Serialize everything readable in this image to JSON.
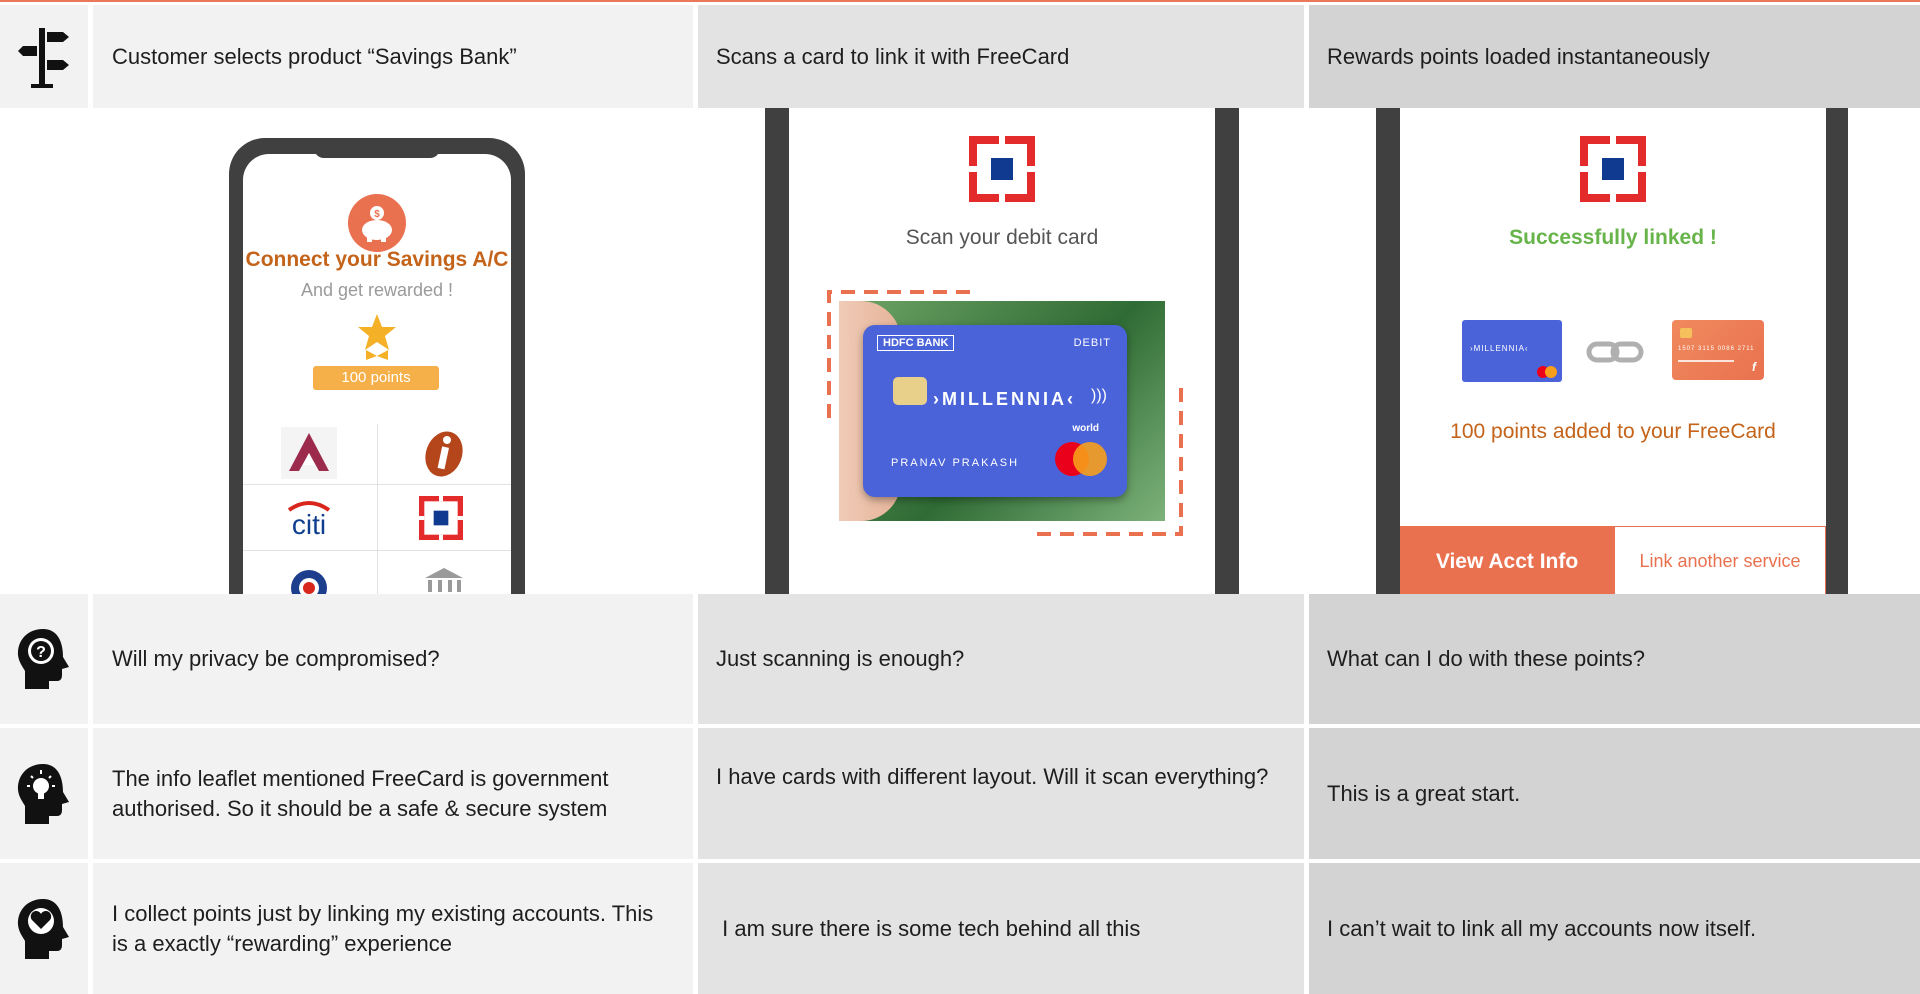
{
  "columns": [
    {
      "step": "Customer selects product “Savings Bank”",
      "question": "Will my privacy be compromised?",
      "thought": "The info leaflet mentioned FreeCard is government authorised. So it should be a safe & secure system",
      "feeling": "I collect points just by linking my existing accounts. This is a exactly “rewarding” experience"
    },
    {
      "step": "Scans a card to link it with FreeCard",
      "question": "Just scanning is enough?",
      "thought": "I have cards with different layout. Will it scan everything?",
      "feeling": " I am sure there is some tech behind all this"
    },
    {
      "step": "Rewards points loaded instantaneously",
      "question": "What can I do with these points?",
      "thought": "This is a great start.",
      "feeling": "I can’t wait to link all my accounts now itself."
    }
  ],
  "row_icons": [
    "signpost-icon",
    "head-question-icon",
    "head-lightbulb-icon",
    "head-heart-icon"
  ],
  "phone1": {
    "title": "Connect your Savings A/C",
    "subtitle": "And get rewarded !",
    "points_badge": "100 points",
    "bank_logos": [
      "axis-bank-logo",
      "icici-bank-logo",
      "citi-bank-logo",
      "hdfc-bank-logo",
      "canara-bank-logo",
      "generic-bank-icon"
    ],
    "citi_text": "citi"
  },
  "phone2": {
    "instruction": "Scan your debit card",
    "card": {
      "bank": "HDFC BANK",
      "type": "DEBIT",
      "name": "›MILLENNIA‹",
      "holder": "PRANAV PRAKASH",
      "network_tag": "world"
    }
  },
  "phone3": {
    "status": "Successfully linked !",
    "points_added": "100 points added to your FreeCard",
    "view_button": "View Acct Info",
    "link_button": "Link another service",
    "mini_card_name": "›MILLENNIA‹",
    "mini_card_number": "1507  3115  0086  2711"
  },
  "colors": {
    "accent": "#e9714f",
    "brand_orange": "#c4631a",
    "success_green": "#67b44a",
    "hdfc_red": "#e32b2b",
    "hdfc_blue": "#103a8f",
    "card_blue": "#4a63d9"
  }
}
